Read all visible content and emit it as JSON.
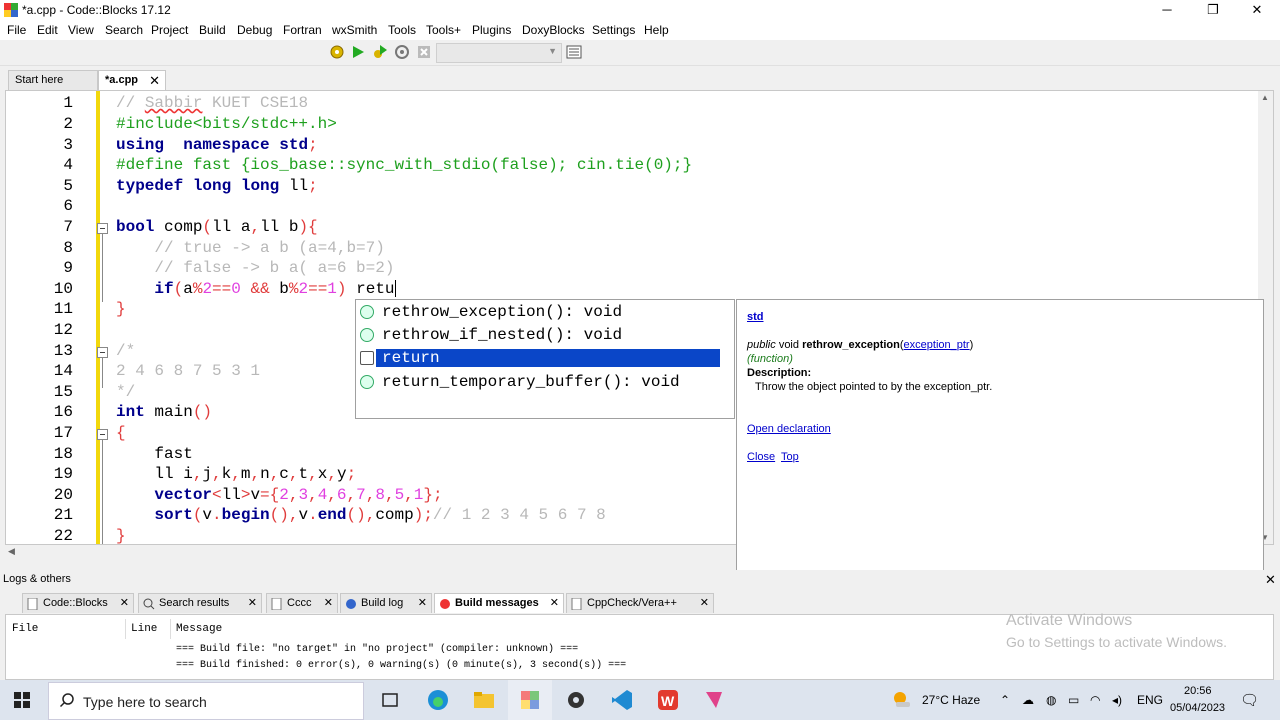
{
  "window": {
    "title": "*a.cpp - Code::Blocks 17.12",
    "minimize": "─",
    "maximize": "❐",
    "close": "✕"
  },
  "menu": [
    "File",
    "Edit",
    "View",
    "Search",
    "Project",
    "Build",
    "Debug",
    "Fortran",
    "wxSmith",
    "Tools",
    "Tools+",
    "Plugins",
    "DoxyBlocks",
    "Settings",
    "Help"
  ],
  "tabs": [
    {
      "label": "Start here"
    },
    {
      "label": "*a.cpp",
      "close": "✕"
    }
  ],
  "editor": {
    "line_numbers": [
      "1",
      "2",
      "3",
      "4",
      "5",
      "6",
      "7",
      "8",
      "9",
      "10",
      "11",
      "12",
      "13",
      "14",
      "15",
      "16",
      "17",
      "18",
      "19",
      "20",
      "21",
      "22"
    ]
  },
  "autocomplete": {
    "items": [
      {
        "label": "rethrow_exception(): void"
      },
      {
        "label": "rethrow_if_nested(): void"
      },
      {
        "label": "return"
      },
      {
        "label": "return_temporary_buffer(): void"
      }
    ]
  },
  "doc": {
    "namespace": "std",
    "sig_public": "public",
    "sig_void": "void",
    "sig_name": "rethrow_exception",
    "sig_param": "exception_ptr",
    "kind": "(function)",
    "desc_label": "Description:",
    "desc": "Throw the object pointed to by the exception_ptr.",
    "open_decl": "Open declaration",
    "close": "Close",
    "top": "Top"
  },
  "logs": {
    "title": "Logs & others",
    "close": "✕",
    "tabs": [
      {
        "label": "Code::Blocks"
      },
      {
        "label": "Search results"
      },
      {
        "label": "Cccc"
      },
      {
        "label": "Build log"
      },
      {
        "label": "Build messages"
      },
      {
        "label": "CppCheck/Vera++"
      }
    ],
    "columns": [
      "File",
      "Line",
      "Message"
    ],
    "messages": [
      "=== Build file: \"no target\" in \"no project\" (compiler: unknown) ===",
      "=== Build finished: 0 error(s), 0 warning(s) (0 minute(s), 3 second(s)) ==="
    ]
  },
  "watermark": {
    "line1": "Activate Windows",
    "line2": "Go to Settings to activate Windows."
  },
  "taskbar": {
    "search_placeholder": "Type here to search",
    "weather": "27°C  Haze",
    "lang": "ENG",
    "time": "20:56",
    "date": "05/04/2023"
  }
}
